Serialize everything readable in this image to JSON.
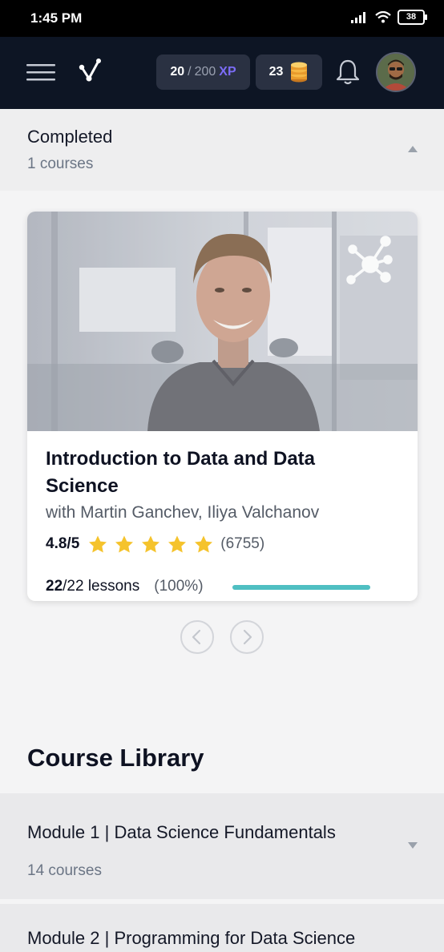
{
  "status_bar": {
    "time": "1:45 PM",
    "battery": "38"
  },
  "header": {
    "xp_current": "20",
    "xp_separator": "/",
    "xp_total": "200",
    "xp_unit": "XP",
    "coins": "23"
  },
  "completed": {
    "title": "Completed",
    "subtitle": "1 courses"
  },
  "course_card": {
    "title": "Introduction to Data and Data Science",
    "author": "with Martin Ganchev, Iliya Valchanov",
    "rating": "4.8/5",
    "rating_value": 4.8,
    "rating_max": 5,
    "rating_count": "(6755)",
    "lessons_done": "22",
    "lessons_rest": "/22 lessons",
    "progress_label": "(100%)",
    "progress_fraction": 1.0
  },
  "library": {
    "heading": "Course Library",
    "modules": [
      {
        "title": "Module 1 | Data Science Fundamentals",
        "subtitle": "14 courses"
      },
      {
        "title": "Module 2 | Programming for Data Science"
      }
    ]
  },
  "colors": {
    "header_bg": "#0d1524",
    "xp_accent": "#7b6cf6",
    "star": "#f5c32c",
    "progress": "#4fbfc2"
  },
  "icons": [
    "menu-icon",
    "logo-icon",
    "coin-stack-icon",
    "bell-icon",
    "share-network-icon",
    "star-icon",
    "chevron-left-icon",
    "chevron-right-icon"
  ]
}
